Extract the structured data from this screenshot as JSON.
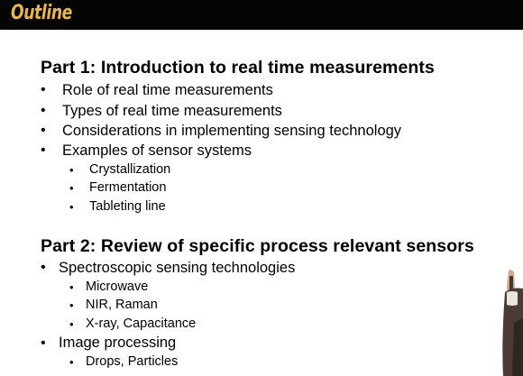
{
  "header": {
    "title": "Outline"
  },
  "part1": {
    "title": "Part 1: Introduction to real time measurements",
    "items": [
      "Role of real time measurements",
      "Types of real time measurements",
      "Considerations in implementing sensing technology",
      "Examples of sensor systems"
    ],
    "subitems": [
      "Crystallization",
      "Fermentation",
      "Tableting line"
    ]
  },
  "part2": {
    "title": "Part 2: Review of specific process relevant sensors",
    "items": [
      "Spectroscopic  sensing technologies",
      "Image processing"
    ],
    "spectroscopy_subitems": [
      "Microwave",
      "NIR, Raman",
      "X-ray, Capacitance"
    ],
    "image_subitems": [
      "Drops, Particles"
    ]
  },
  "bullet_glyph": "•",
  "colors": {
    "header_bg": "#050505",
    "title": "#e8b64a",
    "text": "#000000",
    "background": "#ffffff"
  }
}
